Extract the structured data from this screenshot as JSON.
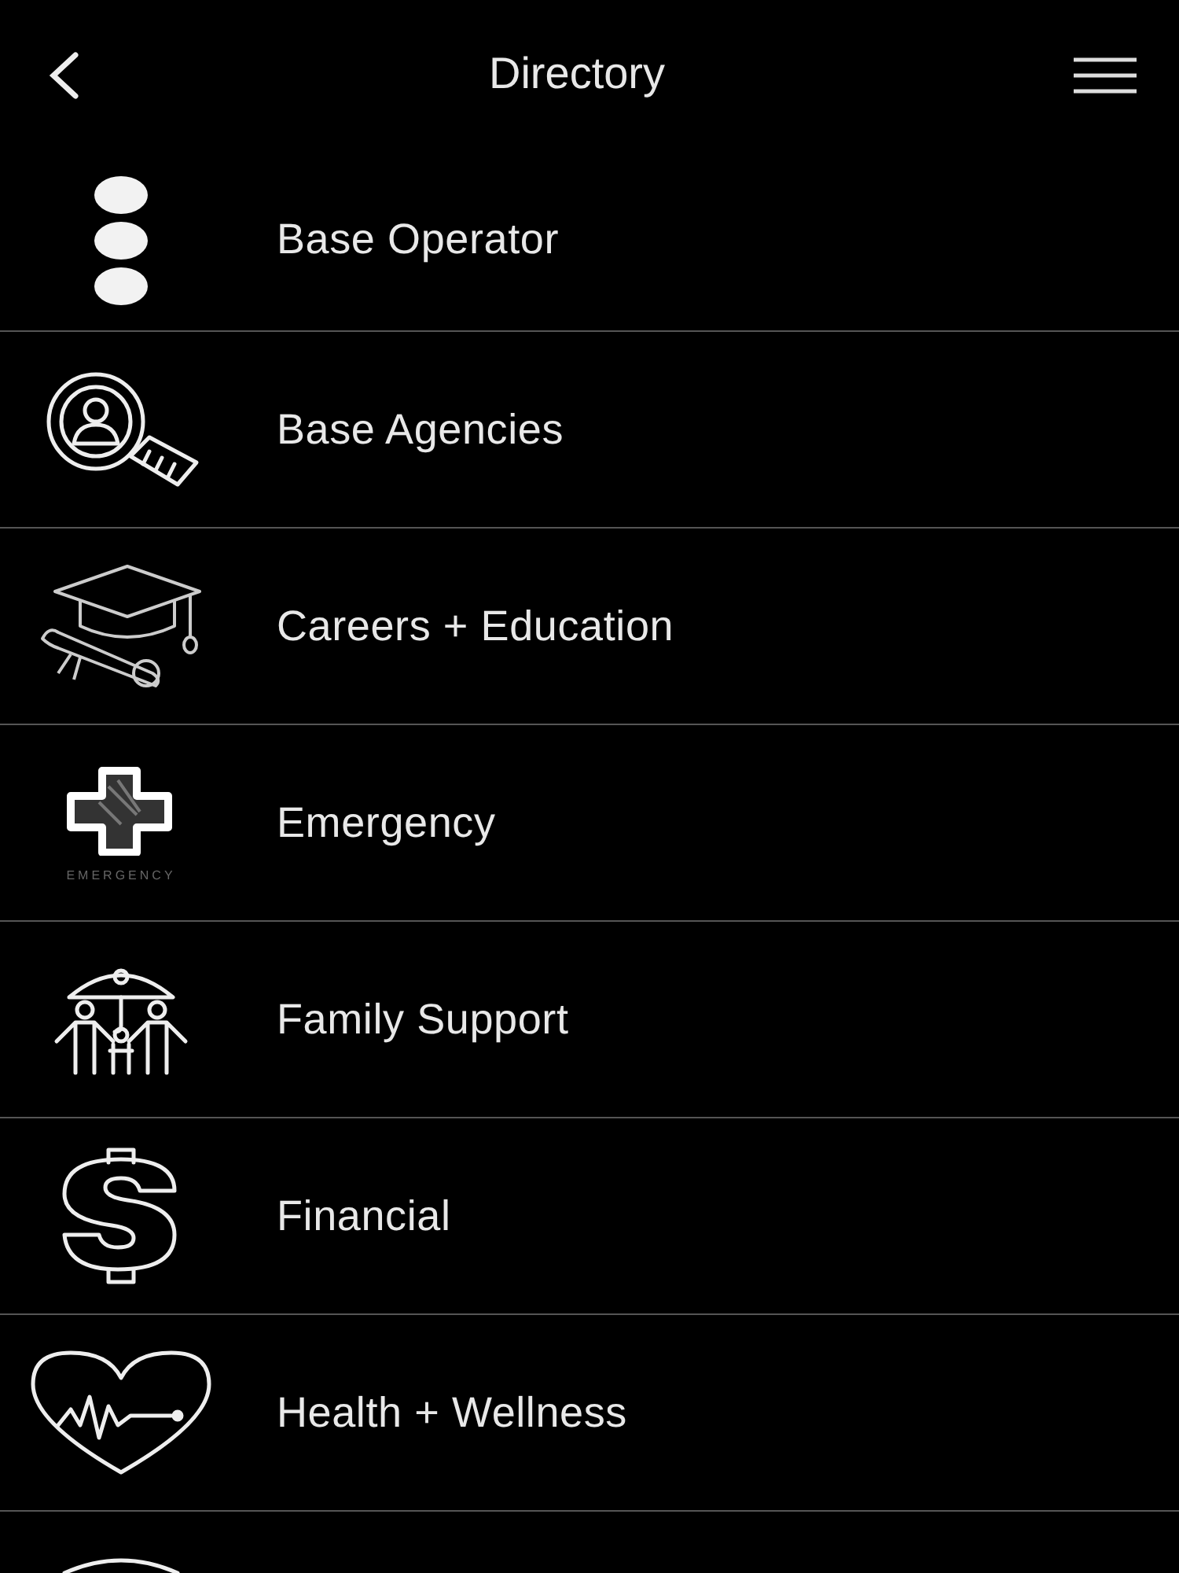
{
  "header": {
    "title": "Directory"
  },
  "items": [
    {
      "kind": "row",
      "label": "Base Operator"
    },
    {
      "kind": "row",
      "label": "Base Agencies"
    },
    {
      "kind": "row",
      "label": "Careers + Education"
    },
    {
      "kind": "row",
      "label": "Emergency",
      "icon_caption": "EMERGENCY"
    },
    {
      "kind": "row",
      "label": "Family Support"
    },
    {
      "kind": "row",
      "label": "Financial"
    },
    {
      "kind": "row",
      "label": "Health + Wellness"
    },
    {
      "kind": "clipped"
    }
  ]
}
